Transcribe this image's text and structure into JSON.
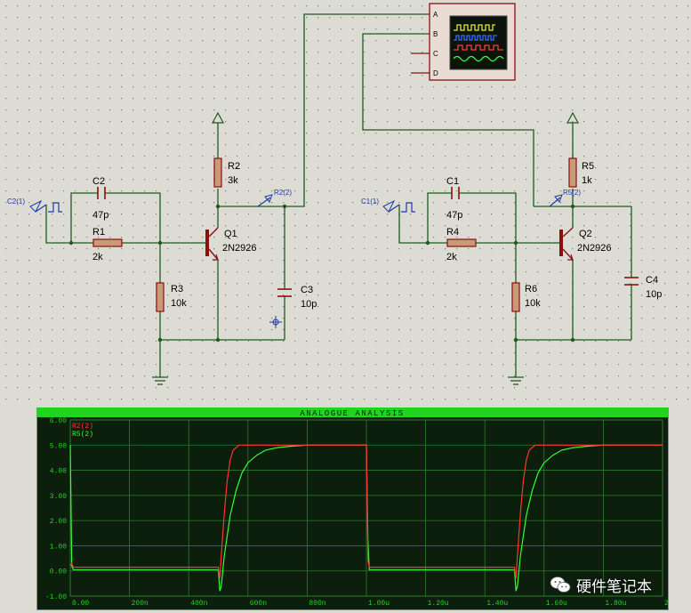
{
  "schematic": {
    "left": {
      "gen": "C2(1)",
      "probe": "R2(2)",
      "C2": {
        "name": "C2",
        "value": "47p"
      },
      "R1": {
        "name": "R1",
        "value": "2k"
      },
      "R2": {
        "name": "R2",
        "value": "3k"
      },
      "R3": {
        "name": "R3",
        "value": "10k"
      },
      "C3": {
        "name": "C3",
        "value": "10p"
      },
      "Q1": {
        "name": "Q1",
        "value": "2N2926"
      }
    },
    "right": {
      "gen": "C1(1)",
      "probe": "R5(2)",
      "C1": {
        "name": "C1",
        "value": "47p"
      },
      "R4": {
        "name": "R4",
        "value": "2k"
      },
      "R5": {
        "name": "R5",
        "value": "1k"
      },
      "R6": {
        "name": "R6",
        "value": "10k"
      },
      "C4": {
        "name": "C4",
        "value": "10p"
      },
      "Q2": {
        "name": "Q2",
        "value": "2N2926"
      }
    },
    "scope": {
      "channels": [
        "A",
        "B",
        "C",
        "D"
      ]
    }
  },
  "analysis": {
    "title": "ANALOGUE ANALYSIS",
    "colors": {
      "frame": "#1fd51f",
      "bg": "#0c1e0c",
      "grid": "#2e7a2e",
      "r2": "#ff3333",
      "r5": "#33ff33"
    }
  },
  "chart_data": {
    "type": "line",
    "title": "ANALOGUE ANALYSIS",
    "xlabel": "",
    "ylabel": "",
    "x_ticks": [
      "0.00",
      "200n",
      "400n",
      "600n",
      "800n",
      "1.00u",
      "1.20u",
      "1.40u",
      "1.60u",
      "1.80u",
      "2.00u"
    ],
    "y_ticks": [
      "6.00",
      "5.00",
      "4.00",
      "3.00",
      "2.00",
      "1.00",
      "0.00",
      "-1.00"
    ],
    "xlim": [
      0,
      2.0
    ],
    "ylim": [
      -1.0,
      6.0
    ],
    "x_unit": "us",
    "series": [
      {
        "name": "R2(2)",
        "color": "#ff3333",
        "x": [
          0,
          0.005,
          0.01,
          0.5,
          0.505,
          0.51,
          0.52,
          0.53,
          0.54,
          0.55,
          0.57,
          0.6,
          0.65,
          0.99,
          0.995,
          1.0,
          1.005,
          1.01,
          1.5,
          1.505,
          1.51,
          1.52,
          1.53,
          1.54,
          1.55,
          1.57,
          1.6,
          1.65,
          2.0
        ],
        "y": [
          0.2,
          0.3,
          0.15,
          0.15,
          -0.3,
          0.6,
          2.3,
          3.6,
          4.4,
          4.8,
          5.0,
          5.0,
          5.0,
          5.0,
          5.0,
          5.0,
          0.4,
          0.15,
          0.15,
          -0.3,
          0.6,
          2.3,
          3.6,
          4.4,
          4.8,
          5.0,
          5.0,
          5.0,
          5.0
        ]
      },
      {
        "name": "R5(2)",
        "color": "#33ff33",
        "x": [
          0,
          0.005,
          0.01,
          0.5,
          0.505,
          0.51,
          0.52,
          0.54,
          0.56,
          0.58,
          0.6,
          0.63,
          0.66,
          0.7,
          0.75,
          0.8,
          0.85,
          0.99,
          1.0,
          1.005,
          1.01,
          1.5,
          1.505,
          1.51,
          1.52,
          1.54,
          1.56,
          1.58,
          1.6,
          1.63,
          1.66,
          1.7,
          1.75,
          1.8,
          2.0
        ],
        "y": [
          5.0,
          0.2,
          0.05,
          0.05,
          -0.8,
          -0.6,
          0.6,
          2.2,
          3.2,
          3.9,
          4.3,
          4.6,
          4.8,
          4.9,
          4.96,
          5.0,
          5.0,
          5.0,
          5.0,
          1.2,
          0.05,
          0.05,
          -0.8,
          -0.6,
          0.6,
          2.2,
          3.2,
          3.9,
          4.3,
          4.6,
          4.8,
          4.9,
          4.96,
          5.0,
          5.0
        ]
      }
    ],
    "grid": true,
    "legend": "top-left"
  },
  "watermark": {
    "text": "硬件笔记本"
  }
}
